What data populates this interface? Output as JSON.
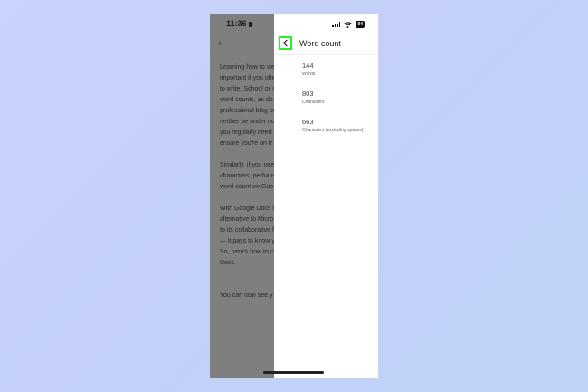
{
  "status_bar": {
    "time": "11:36",
    "battery": "94"
  },
  "document": {
    "back_glyph": "‹",
    "paragraphs": [
      [
        "Learning how to vie",
        "important if you ofte",
        "to write. School or s",
        "word counts, as do",
        "professional blog po",
        "neither be under no",
        "you regularly need",
        "ensure you're on tr"
      ],
      [
        "Similarly, if you nee",
        "characters, perhaps",
        "word count on Goo"
      ],
      [
        "With Google Docs b",
        "alternative to Micro",
        "to its collaborative f",
        "— it pays to know y",
        "So, here's how to c",
        "Docs."
      ],
      [
        "You can now see y"
      ]
    ]
  },
  "panel": {
    "title": "Word count",
    "back_icon": "chevron-left-icon",
    "highlight_color": "#25f12c",
    "stats": [
      {
        "value": "144",
        "label": "Words"
      },
      {
        "value": "803",
        "label": "Characters"
      },
      {
        "value": "663",
        "label": "Characters (excluding spaces)"
      }
    ]
  }
}
